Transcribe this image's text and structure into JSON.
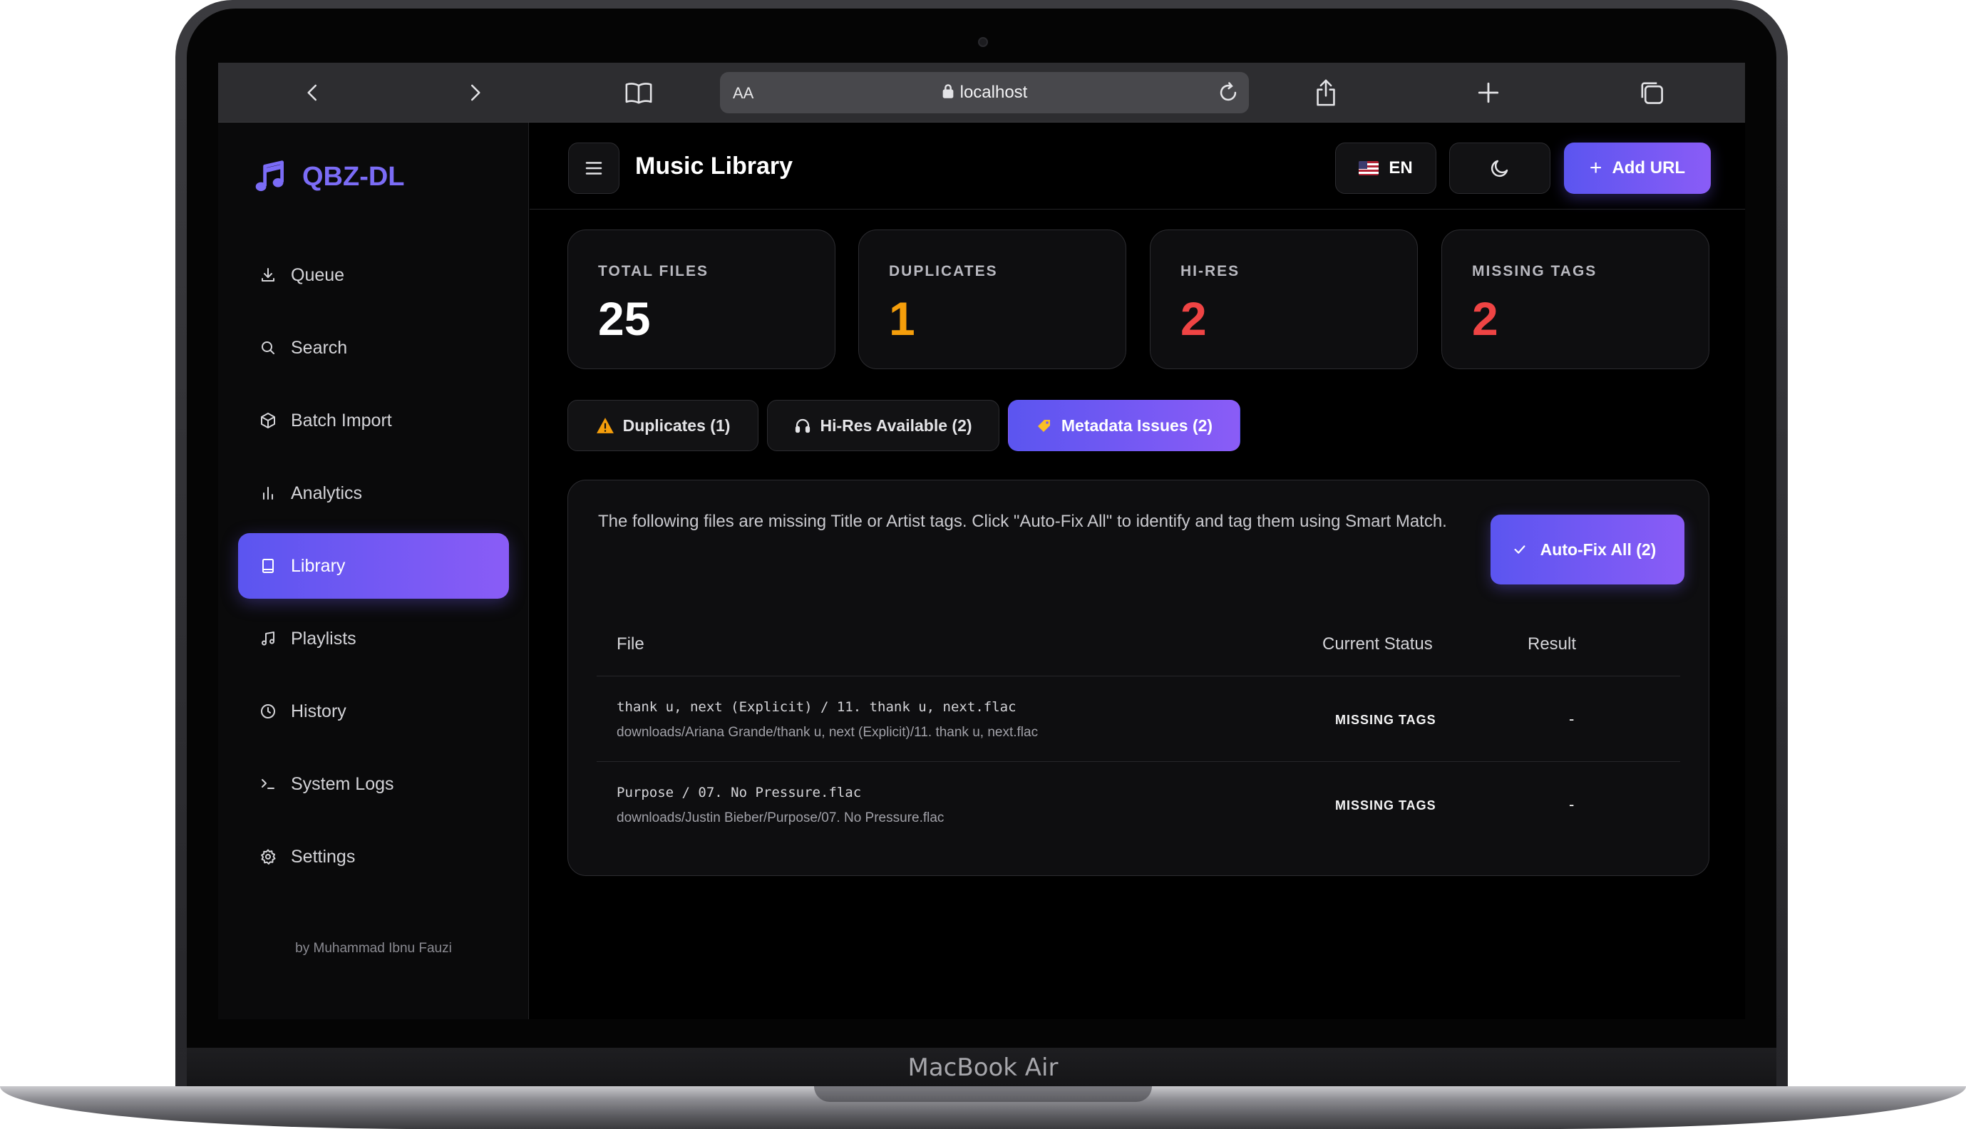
{
  "device": {
    "model_label": "MacBook Air"
  },
  "browser": {
    "aa_label": "AA",
    "url": "localhost"
  },
  "sidebar": {
    "brand": "QBZ-DL",
    "items": [
      {
        "label": "Queue",
        "icon": "download-icon"
      },
      {
        "label": "Search",
        "icon": "search-icon"
      },
      {
        "label": "Batch Import",
        "icon": "package-icon"
      },
      {
        "label": "Analytics",
        "icon": "bar-chart-icon"
      },
      {
        "label": "Library",
        "icon": "book-icon",
        "active": true
      },
      {
        "label": "Playlists",
        "icon": "music-note-icon"
      },
      {
        "label": "History",
        "icon": "clock-icon"
      },
      {
        "label": "System Logs",
        "icon": "terminal-icon"
      },
      {
        "label": "Settings",
        "icon": "gear-icon"
      }
    ],
    "author": "by Muhammad Ibnu Fauzi"
  },
  "header": {
    "title": "Music Library",
    "language": "EN",
    "add_url_label": "Add URL"
  },
  "stats": [
    {
      "label": "TOTAL FILES",
      "value": "25",
      "color": "#ffffff"
    },
    {
      "label": "DUPLICATES",
      "value": "1",
      "color": "#f59e0b"
    },
    {
      "label": "HI-RES",
      "value": "2",
      "color": "#ef4444"
    },
    {
      "label": "MISSING TAGS",
      "value": "2",
      "color": "#ef4444"
    }
  ],
  "tabs": [
    {
      "label": "Duplicates (1)",
      "icon": "warning-icon"
    },
    {
      "label": "Hi-Res Available (2)",
      "icon": "headphones-icon"
    },
    {
      "label": "Metadata Issues (2)",
      "icon": "tag-icon",
      "active": true
    }
  ],
  "panel": {
    "description": "The following files are missing Title or Artist tags. Click \"Auto-Fix All\" to identify and tag them using Smart Match.",
    "fix_button_label": "Auto-Fix All (2)",
    "columns": [
      "File",
      "Current Status",
      "Result"
    ],
    "rows": [
      {
        "file": "thank u, next (Explicit) / 11. thank u, next.flac",
        "path": "downloads/Ariana Grande/thank u, next (Explicit)/11. thank u, next.flac",
        "status": "MISSING TAGS",
        "result": "-"
      },
      {
        "file": "Purpose / 07. No Pressure.flac",
        "path": "downloads/Justin Bieber/Purpose/07. No Pressure.flac",
        "status": "MISSING TAGS",
        "result": "-"
      }
    ]
  },
  "theme": {
    "accent_start": "#5b55f0",
    "accent_end": "#8a5cf6",
    "brand_color": "#7b6cf6",
    "background": "#000000"
  }
}
